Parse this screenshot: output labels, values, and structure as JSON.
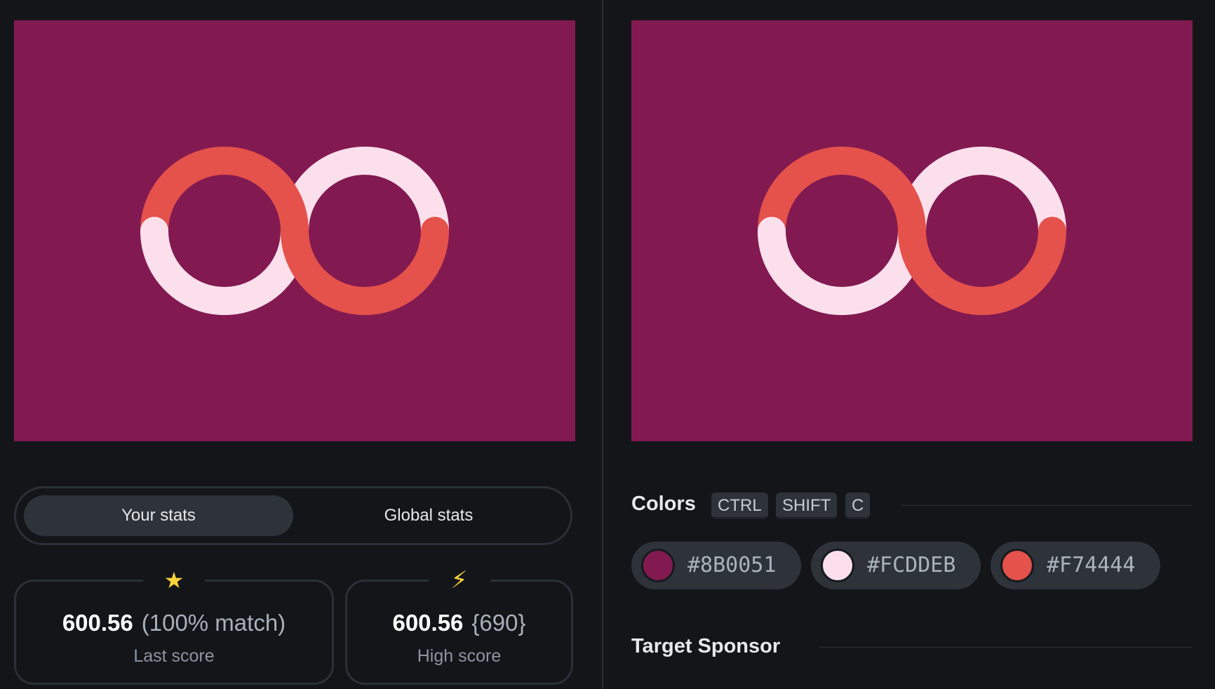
{
  "palette": {
    "background": "#8B0051",
    "light": "#FCDDEB",
    "accent": "#F74444"
  },
  "stats": {
    "tabs": {
      "your_stats": "Your stats",
      "global_stats": "Global stats",
      "active": "your_stats"
    },
    "last_score": {
      "icon": "star-icon",
      "icon_glyph": "★",
      "value": "600.56",
      "extra": "(100% match)",
      "label": "Last score"
    },
    "high_score": {
      "icon": "lightning-icon",
      "icon_glyph": "⚡",
      "value": "600.56",
      "extra": "{690}",
      "label": "High score"
    }
  },
  "colors_section": {
    "title": "Colors",
    "shortcut_keys": [
      "CTRL",
      "SHIFT",
      "C"
    ],
    "swatches": [
      {
        "hex": "#8B0051",
        "color": "#821a51"
      },
      {
        "hex": "#FCDDEB",
        "color": "#fbe0ec"
      },
      {
        "hex": "#F74444",
        "color": "#e5514b"
      }
    ]
  },
  "sponsor_section": {
    "title": "Target Sponsor"
  }
}
